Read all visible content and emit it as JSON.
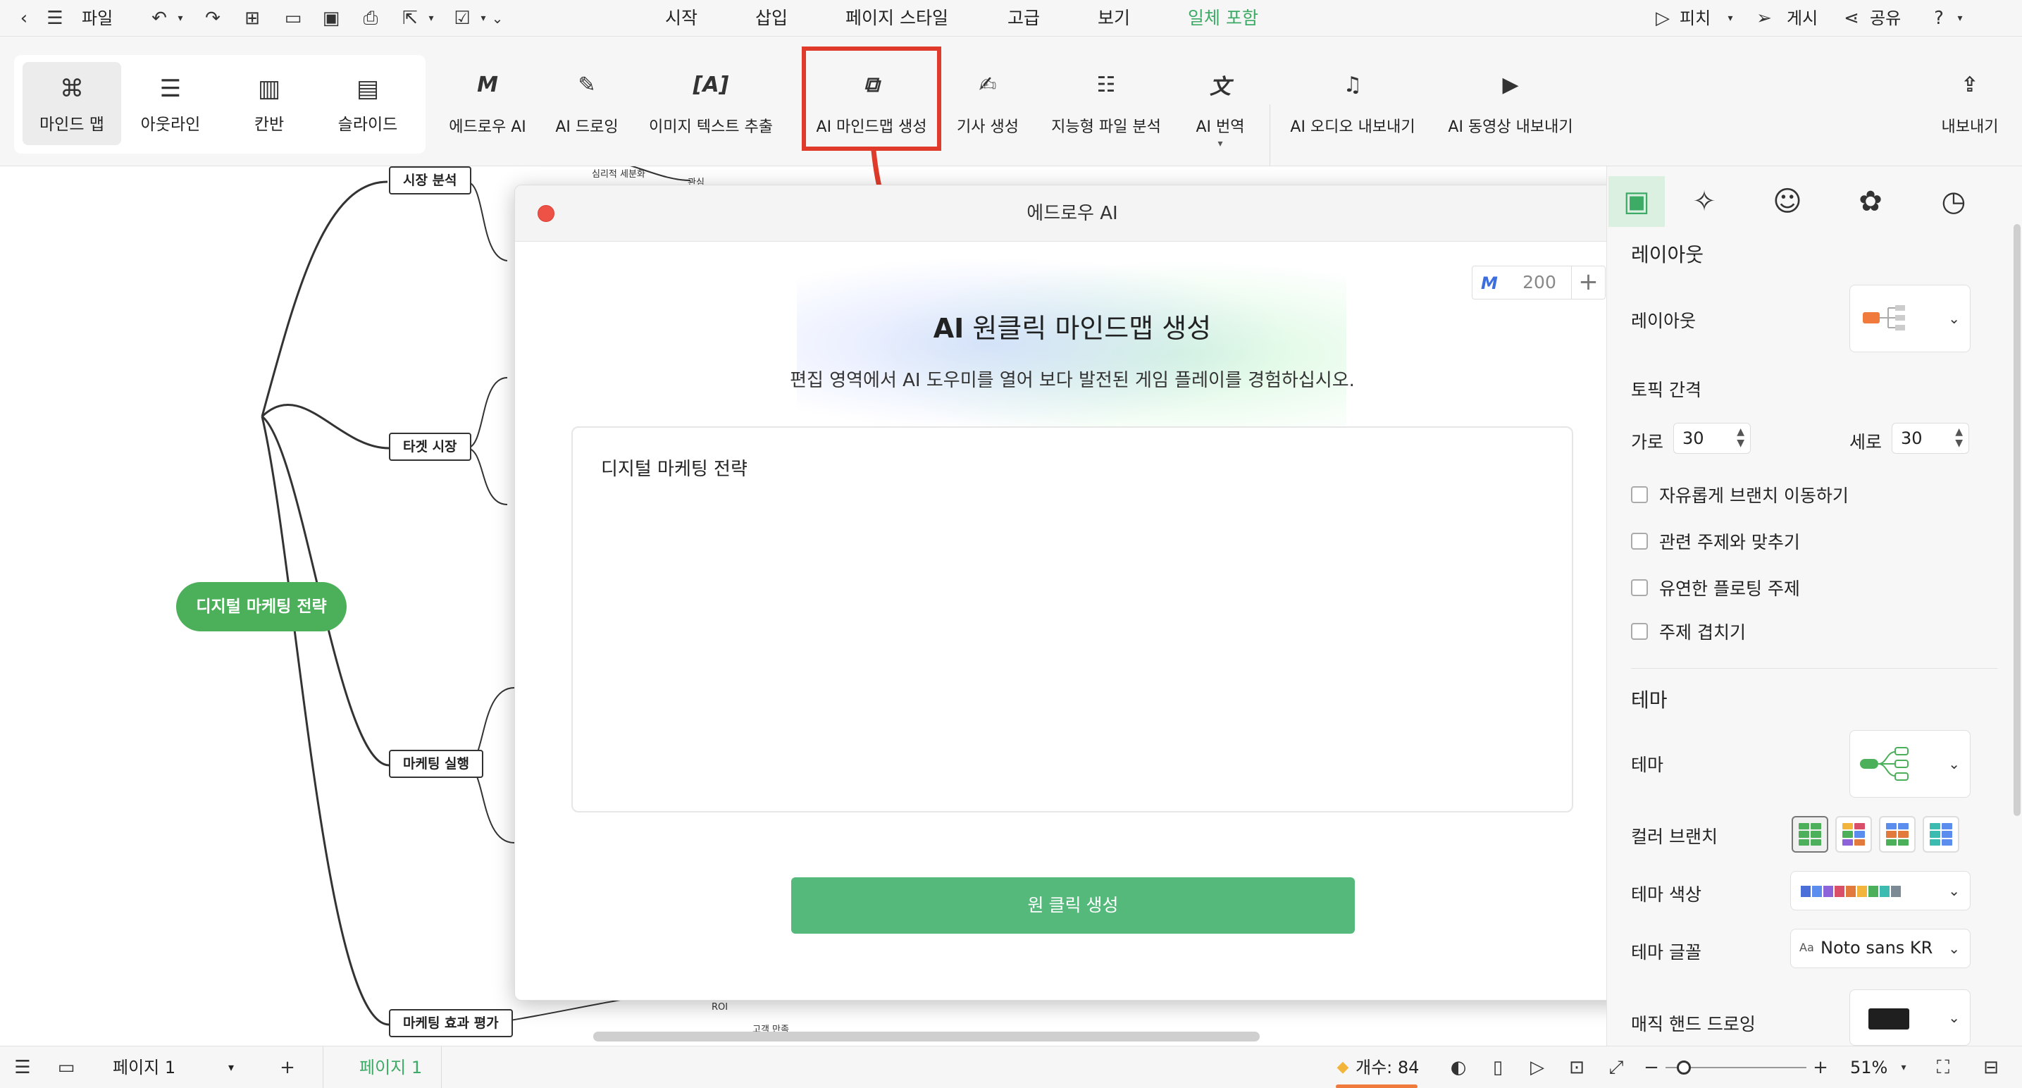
{
  "menubar": {
    "file": "파일",
    "tabs": [
      {
        "label": "시작"
      },
      {
        "label": "삽입"
      },
      {
        "label": "페이지 스타일"
      },
      {
        "label": "고급"
      },
      {
        "label": "보기"
      },
      {
        "label": "일체 포함"
      }
    ],
    "pitch": "피치",
    "publish": "게시",
    "share": "공유"
  },
  "ribbon": {
    "views": [
      {
        "label": "마인드 맵",
        "icon": "mindmap-icon"
      },
      {
        "label": "아웃라인",
        "icon": "outline-icon"
      },
      {
        "label": "칸반",
        "icon": "kanban-icon"
      },
      {
        "label": "슬라이드",
        "icon": "slide-icon"
      }
    ],
    "ai_tools": [
      {
        "label": "에드로우 AI",
        "icon": "edraw-ai-icon"
      },
      {
        "label": "AI 드로잉",
        "icon": "ai-drawing-icon"
      },
      {
        "label": "이미지 텍스트 추출",
        "icon": "text-extract-icon"
      },
      {
        "label": "AI 마인드맵 생성",
        "icon": "ai-mindmap-icon"
      },
      {
        "label": "기사 생성",
        "icon": "article-icon"
      },
      {
        "label": "지능형 파일 분석",
        "icon": "file-analysis-icon"
      },
      {
        "label": "AI 번역",
        "icon": "translate-icon"
      },
      {
        "label": "AI 오디오 내보내기",
        "icon": "audio-export-icon"
      },
      {
        "label": "AI 동영상 내보내기",
        "icon": "video-export-icon"
      }
    ],
    "export": "내보내기"
  },
  "canvas": {
    "central_topic": "디지털 마케팅 전략",
    "topics": [
      {
        "label": "시장 분석"
      },
      {
        "label": "타겟 시장"
      },
      {
        "label": "마케팅 실행"
      },
      {
        "label": "마케팅 효과 평가"
      }
    ],
    "tiny_labels": [
      "심리적 세분화",
      "관심",
      "ROI",
      "고객 만족"
    ]
  },
  "dialog": {
    "title": "에드로우 AI",
    "credits": "200",
    "heading_ai": "AI",
    "heading_rest": " 원클릭 마인드맵 생성",
    "subtitle": "편집 영역에서 AI 도우미를 열어 보다 발전된 게임 플레이를 경험하십시오.",
    "prompt_value": "디지털 마케팅 전략",
    "generate_label": "원 클릭 생성"
  },
  "right_panel": {
    "layout_section": "레이아웃",
    "layout_label": "레이아웃",
    "topic_spacing": "토픽 간격",
    "horizontal_label": "가로",
    "horizontal_value": "30",
    "vertical_label": "세로",
    "vertical_value": "30",
    "checkboxes": [
      {
        "label": "자유롭게 브랜치 이동하기"
      },
      {
        "label": "관련 주제와 맞추기"
      },
      {
        "label": "유연한 플로팅 주제"
      },
      {
        "label": "주제 겹치기"
      }
    ],
    "theme_section": "테마",
    "theme_label": "테마",
    "color_branch_label": "컬러 브랜치",
    "theme_color_label": "테마 색상",
    "theme_font_label": "테마 글꼴",
    "theme_font_value": "Noto sans KR",
    "theme_font_prefix": "Aa",
    "magic_hand_label": "매직 핸드 드로잉",
    "theme_colors": [
      "#4a6fd8",
      "#5b8def",
      "#8c63d8",
      "#d94f6a",
      "#e2793d",
      "#f2b43a",
      "#4caf5a",
      "#3cbcb0",
      "#7c8a96"
    ],
    "accent": "#3dab66"
  },
  "statusbar": {
    "page_select": "페이지 1",
    "page_tab": "페이지 1",
    "count": "개수: 84",
    "zoom": "51%"
  }
}
